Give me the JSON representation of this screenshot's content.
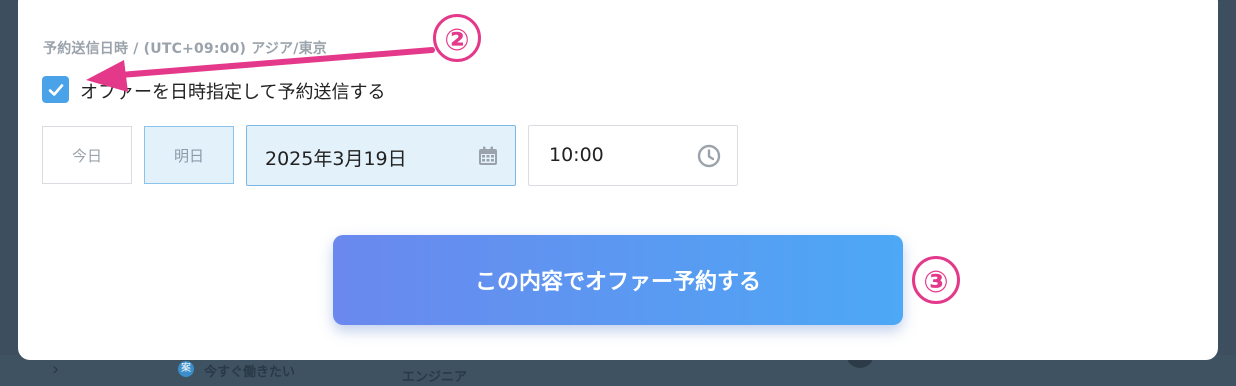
{
  "background": {
    "row_badge": "案",
    "row_text": "今すぐ働きたい",
    "row_role": "エンジニア"
  },
  "schedule": {
    "section_label": "予約送信日時 / (UTC+09:00) アジア/東京",
    "checkbox_label": "オファーを日時指定して予約送信する",
    "checkbox_checked": true,
    "today_label": "今日",
    "tomorrow_label": "明日",
    "date_value": "2025年3月19日",
    "time_value": "10:00"
  },
  "submit": {
    "label": "この内容でオファー予約する"
  },
  "annotations": {
    "step2": "②",
    "step3": "③"
  },
  "colors": {
    "accent": "#4aa3e8",
    "annotation": "#e4398a",
    "button_start": "#6a88ee",
    "button_end": "#4da8f5"
  }
}
